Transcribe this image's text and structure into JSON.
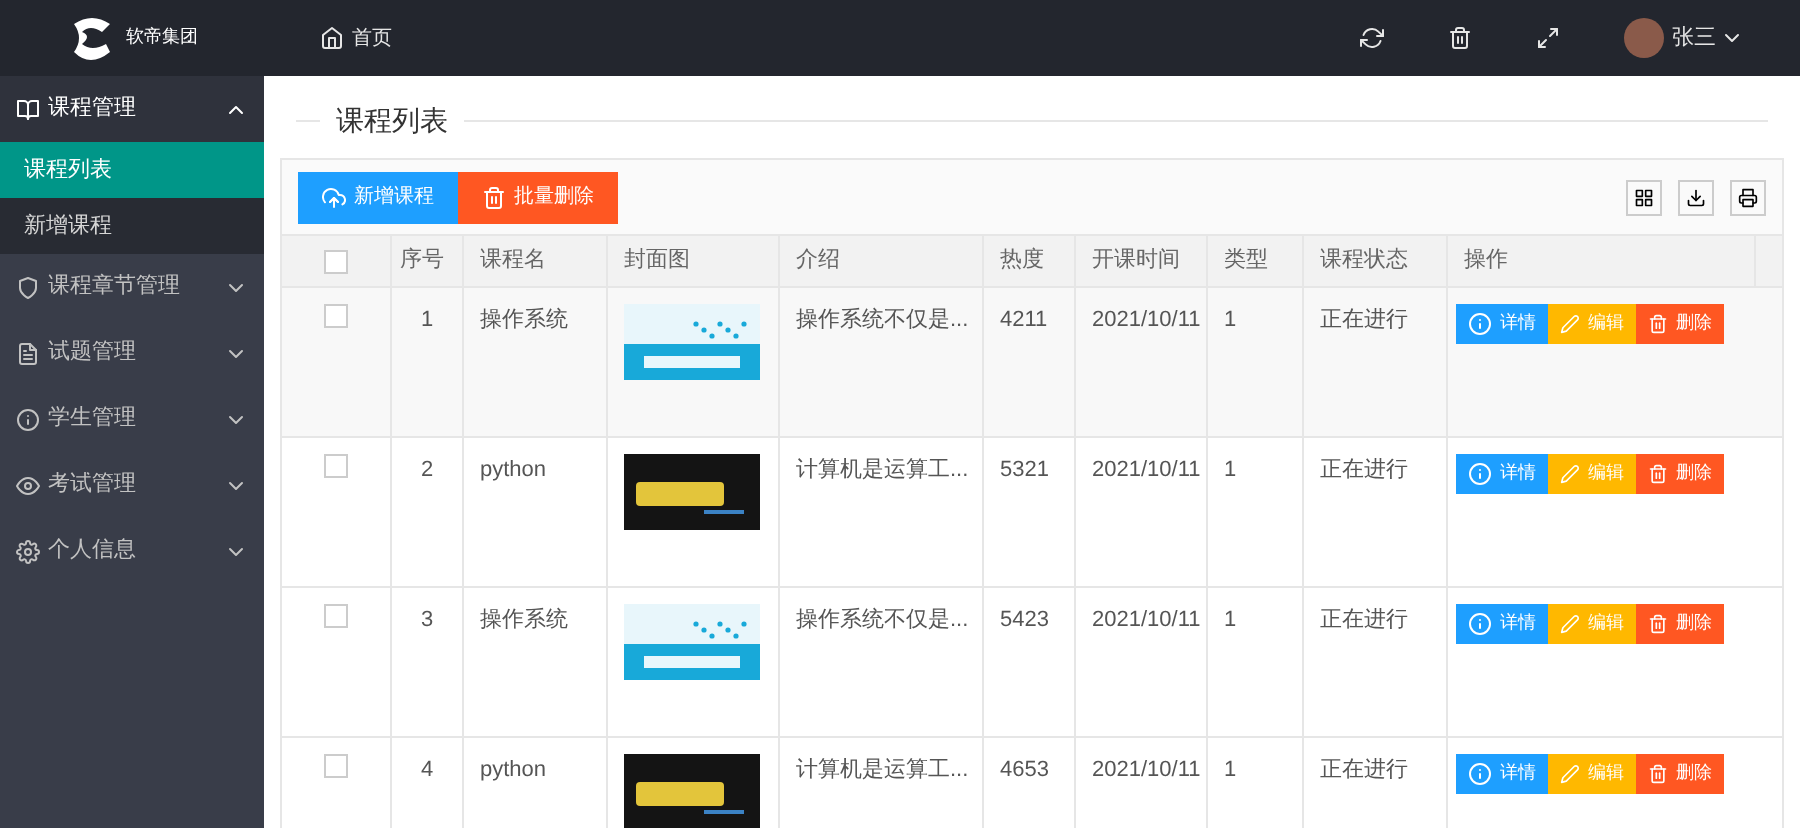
{
  "logo": {
    "text": "软帝集团"
  },
  "sidebar": {
    "items": [
      {
        "label": "课程管理",
        "expanded": true,
        "children": [
          {
            "label": "课程列表",
            "selected": true
          },
          {
            "label": "新增课程",
            "selected": false
          }
        ]
      },
      {
        "label": "课程章节管理",
        "expanded": false
      },
      {
        "label": "试题管理",
        "expanded": false
      },
      {
        "label": "学生管理",
        "expanded": false
      },
      {
        "label": "考试管理",
        "expanded": false
      },
      {
        "label": "个人信息",
        "expanded": false
      }
    ]
  },
  "topbar": {
    "home": "首页",
    "user": "张三"
  },
  "page_title": "课程列表",
  "toolbar": {
    "buttons": [
      {
        "label": "新增课程",
        "kind": "add"
      },
      {
        "label": "批量删除",
        "kind": "delete"
      }
    ]
  },
  "table": {
    "select_all_checked": false,
    "columns": [
      "序号",
      "课程名",
      "封面图",
      "介绍",
      "热度",
      "开课时间",
      "类型",
      "课程状态",
      "操作"
    ],
    "rows": [
      {
        "checked": false,
        "kind": "os",
        "cells": [
          "1",
          "操作系统",
          "",
          "操作系统不仅是...",
          "4211",
          "2021/10/11",
          "1",
          "正在进行"
        ],
        "actions": [
          "详情",
          "编辑",
          "删除"
        ]
      },
      {
        "checked": false,
        "kind": "python",
        "cells": [
          "2",
          "python",
          "",
          "计算机是运算工...",
          "5321",
          "2021/10/11",
          "1",
          "正在进行"
        ],
        "actions": [
          "详情",
          "编辑",
          "删除"
        ]
      },
      {
        "checked": false,
        "kind": "os",
        "cells": [
          "3",
          "操作系统",
          "",
          "操作系统不仅是...",
          "5423",
          "2021/10/11",
          "1",
          "正在进行"
        ],
        "actions": [
          "详情",
          "编辑",
          "删除"
        ]
      },
      {
        "checked": false,
        "kind": "python",
        "cells": [
          "4",
          "python",
          "",
          "计算机是运算工...",
          "4653",
          "2021/10/11",
          "1",
          "正在进行"
        ],
        "actions": [
          "详情",
          "编辑",
          "删除"
        ]
      }
    ]
  }
}
